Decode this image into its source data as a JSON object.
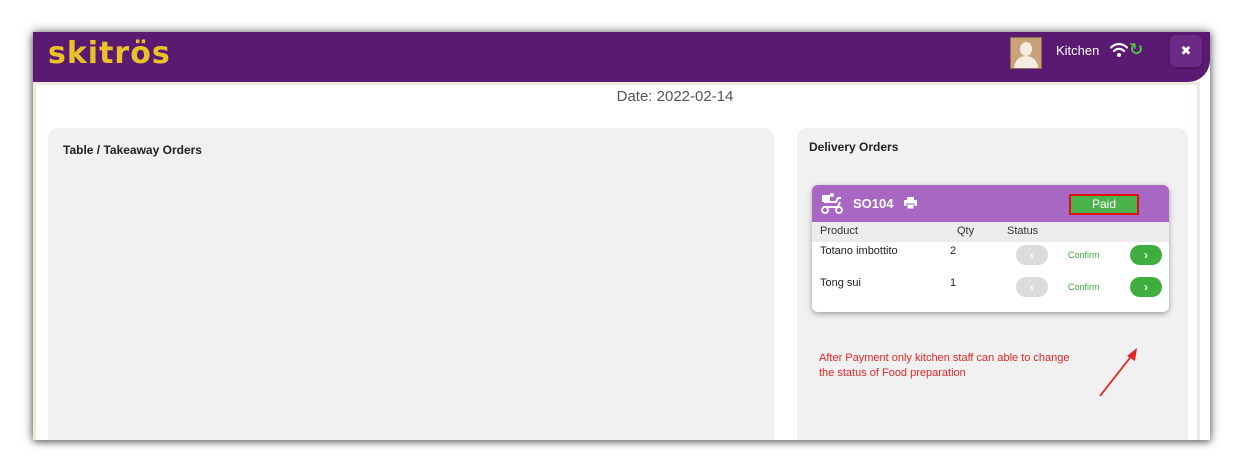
{
  "app": {
    "logo_text": "skitrös",
    "user_name": "Kitchen",
    "close_label": "✖",
    "sync_glyph": "↻"
  },
  "date_label": "Date: 2022-02-14",
  "table_panel": {
    "title": "Table / Takeaway Orders"
  },
  "delivery_panel": {
    "title": "Delivery Orders",
    "order": {
      "id": "SO104",
      "payment_status": "Paid",
      "columns": [
        "Product",
        "Qty",
        "Status"
      ],
      "items": [
        {
          "product": "Totano imbottito",
          "qty": "2",
          "status": "Confirm",
          "back": "‹",
          "forward": "›"
        },
        {
          "product": "Tong sui",
          "qty": "1",
          "status": "Confirm",
          "back": "‹",
          "forward": "›"
        }
      ]
    }
  },
  "annotation": {
    "line1": "After Payment only kitchen staff can able to change",
    "line2": "the status of Food preparation"
  },
  "colors": {
    "topbar": "#5b1a72",
    "logo": "#e9c325",
    "card_header": "#a967c4",
    "paid_badge": "#4cb24c",
    "highlight_border": "#e01010",
    "confirm_green": "#3fae3f",
    "annotation_red": "#e32727"
  },
  "icons": [
    "avatar",
    "wifi-icon",
    "sync-icon",
    "close-icon",
    "delivery-scooter-icon",
    "print-icon",
    "chevron-left-icon",
    "chevron-right-icon"
  ]
}
